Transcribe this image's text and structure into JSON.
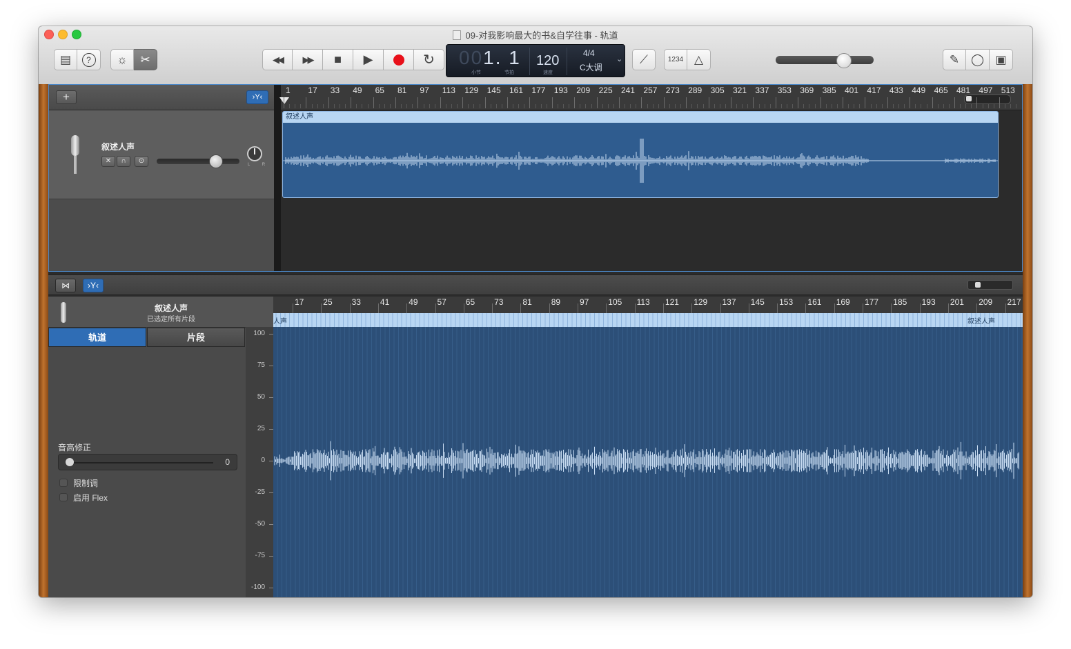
{
  "window": {
    "title": "09-对我影响最大的书&自学往事 - 轨道"
  },
  "toolbar": {
    "left_buttons": [
      {
        "name": "library",
        "icon": "library-icon",
        "glyph": "▤"
      },
      {
        "name": "quick-help",
        "icon": "help-icon",
        "glyph": "?"
      },
      {
        "name": "smart-controls",
        "icon": "dial-icon",
        "glyph": "☼"
      },
      {
        "name": "editors",
        "icon": "scissors-icon",
        "glyph": "✂"
      }
    ],
    "transport": [
      {
        "name": "rewind",
        "icon": "rewind-icon",
        "glyph": "◀◀"
      },
      {
        "name": "fast-forward",
        "icon": "fast-forward-icon",
        "glyph": "▶▶"
      },
      {
        "name": "stop",
        "icon": "stop-icon",
        "glyph": "■"
      },
      {
        "name": "play",
        "icon": "play-icon",
        "glyph": "▶"
      },
      {
        "name": "record",
        "icon": "record-icon",
        "glyph": ""
      },
      {
        "name": "cycle",
        "icon": "cycle-icon",
        "glyph": "↻"
      }
    ],
    "lcd": {
      "position_dim": "00",
      "position": "1. 1",
      "bar_label": "小节",
      "beat_label": "节拍",
      "tempo": "120",
      "tempo_label": "速度",
      "time_signature": "4/4",
      "key": "C大调",
      "dropdown": "⌄"
    },
    "right_tools": [
      {
        "name": "tuner",
        "icon": "tuner-icon",
        "glyph": "⟋"
      },
      {
        "name": "count-in",
        "icon": "count-in-icon",
        "glyph": "1234"
      },
      {
        "name": "metronome",
        "icon": "metronome-icon",
        "glyph": "△"
      }
    ],
    "master_volume": 0.7,
    "far_right": [
      {
        "name": "notepad",
        "icon": "notepad-icon",
        "glyph": "✎"
      },
      {
        "name": "loops",
        "icon": "loop-browser-icon",
        "glyph": "◯"
      },
      {
        "name": "media-browser",
        "icon": "media-browser-icon",
        "glyph": "▣"
      }
    ]
  },
  "tracks_header": {
    "add_label": "+",
    "filter_label": "›Y‹"
  },
  "track": {
    "name": "叙述人声",
    "mute_glyph": "✕",
    "headphones_glyph": "∩",
    "record_glyph": "⊙",
    "volume": 0.7,
    "pan_lr": "L R"
  },
  "ruler": {
    "numbers": [
      "1",
      "17",
      "33",
      "49",
      "65",
      "81",
      "97",
      "113",
      "129",
      "145",
      "161",
      "177",
      "193",
      "209",
      "225",
      "241",
      "257",
      "273",
      "289",
      "305",
      "321",
      "337",
      "353",
      "369",
      "385",
      "401",
      "417",
      "433",
      "449",
      "465",
      "481",
      "497",
      "513"
    ]
  },
  "region": {
    "name": "叙述人声"
  },
  "midbar": {
    "btn_a": "⋈",
    "btn_b": "›Y‹"
  },
  "editor": {
    "track_name": "叙述人声",
    "subtitle": "已选定所有片段",
    "tabs": [
      "轨道",
      "片段"
    ],
    "pitch_label": "音高修正",
    "pitch_value": "0",
    "checkbox1": "限制调",
    "checkbox2": "启用 Flex",
    "scale": [
      "100",
      "75",
      "50",
      "25",
      "0",
      "-25",
      "-50",
      "-75",
      "-100"
    ],
    "ruler": [
      "17",
      "25",
      "33",
      "41",
      "49",
      "57",
      "65",
      "73",
      "81",
      "89",
      "97",
      "105",
      "113",
      "121",
      "129",
      "137",
      "145",
      "153",
      "161",
      "169",
      "177",
      "185",
      "193",
      "201",
      "209",
      "217"
    ],
    "region_label_left": "人声",
    "region_label_right": "叙述人声"
  },
  "colors": {
    "accent": "#2f6db5",
    "region_fill": "#2f5c8f",
    "region_header": "#b8d6f3",
    "wave": "#c8dcf2",
    "record": "#e8101a"
  }
}
